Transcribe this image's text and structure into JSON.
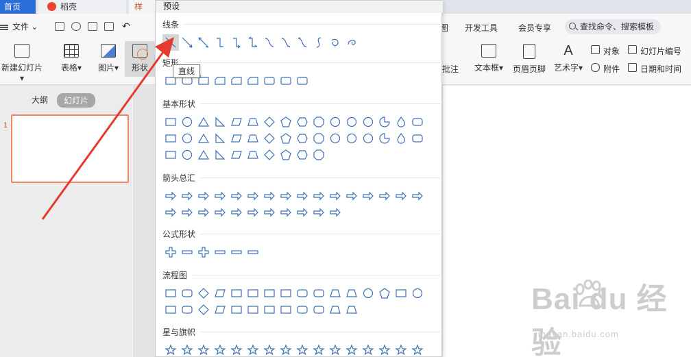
{
  "tabs": [
    {
      "label": "首页"
    },
    {
      "label": "稻壳"
    },
    {
      "label": "样"
    }
  ],
  "menu": {
    "file_label": "文件",
    "right_items": [
      "图",
      "开发工具",
      "会员专享"
    ],
    "search_placeholder": "查找命令、搜索模板"
  },
  "ribbon": {
    "new_slide": "新建幻灯片",
    "table": "表格",
    "picture": "图片",
    "shape": "形状",
    "comment": "批注",
    "textbox": "文本框",
    "header_footer": "页眉页脚",
    "wordart": "艺术字",
    "object": "对象",
    "slide_number": "幻灯片编号",
    "attachment": "附件",
    "date_time": "日期和时间"
  },
  "left_panel": {
    "outline_tab": "大纲",
    "slides_tab": "幻灯片",
    "slide_number": "1"
  },
  "shape_panel": {
    "header": "预设",
    "tooltip": "直线",
    "sections": [
      {
        "title": "线条",
        "count": 12
      },
      {
        "title": "矩形",
        "count": 9
      },
      {
        "title": "基本形状",
        "count": 42
      },
      {
        "title": "箭头总汇",
        "count": 27
      },
      {
        "title": "公式形状",
        "count": 6
      },
      {
        "title": "流程图",
        "count": 28
      },
      {
        "title": "星与旗帜",
        "count": 16
      }
    ]
  },
  "watermark": {
    "text": "Bai du 经验",
    "url": "jingyan.baidu.com"
  },
  "colors": {
    "accent": "#2b6dd9",
    "shape_stroke": "#3d6fb8",
    "annotation": "#e53a2e"
  }
}
